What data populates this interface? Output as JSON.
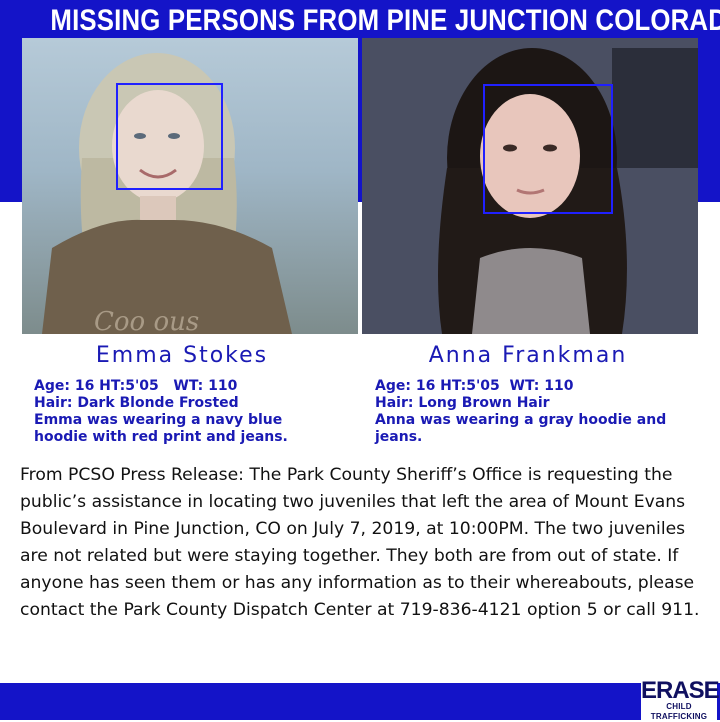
{
  "title": "MISSING PERSONS FROM PINE JUNCTION COLORADO",
  "persons": [
    {
      "name": "Emma Stokes",
      "stats": "Age: 16 HT:5'05   WT: 110",
      "hair": "Hair: Dark Blonde Frosted",
      "clothing": "Emma was wearing a navy blue hoodie with red print and jeans."
    },
    {
      "name": "Anna Frankman",
      "stats": "Age: 16 HT:5'05  WT: 110",
      "hair": "Hair: Long Brown Hair",
      "clothing": "Anna was wearing a gray hoodie and jeans."
    }
  ],
  "release": "From PCSO Press Release: The Park County Sheriff’s Office is requesting the public’s assistance in locating two juveniles that left the area of Mount Evans Boulevard in Pine Junction, CO on July 7, 2019, at 10:00PM. The two juveniles are not related but were staying together. They both are from out of state. If anyone has seen them or has any information as to their whereabouts, please contact the Park County Dispatch Center at 719-836-4121 option 5 or call 911.",
  "logo": {
    "main": "ERASE",
    "sub": "CHILD TRAFFICKING"
  },
  "colors": {
    "band": "#1414c8",
    "name_text": "#1a1ab4",
    "face_box": "#2020ff"
  }
}
